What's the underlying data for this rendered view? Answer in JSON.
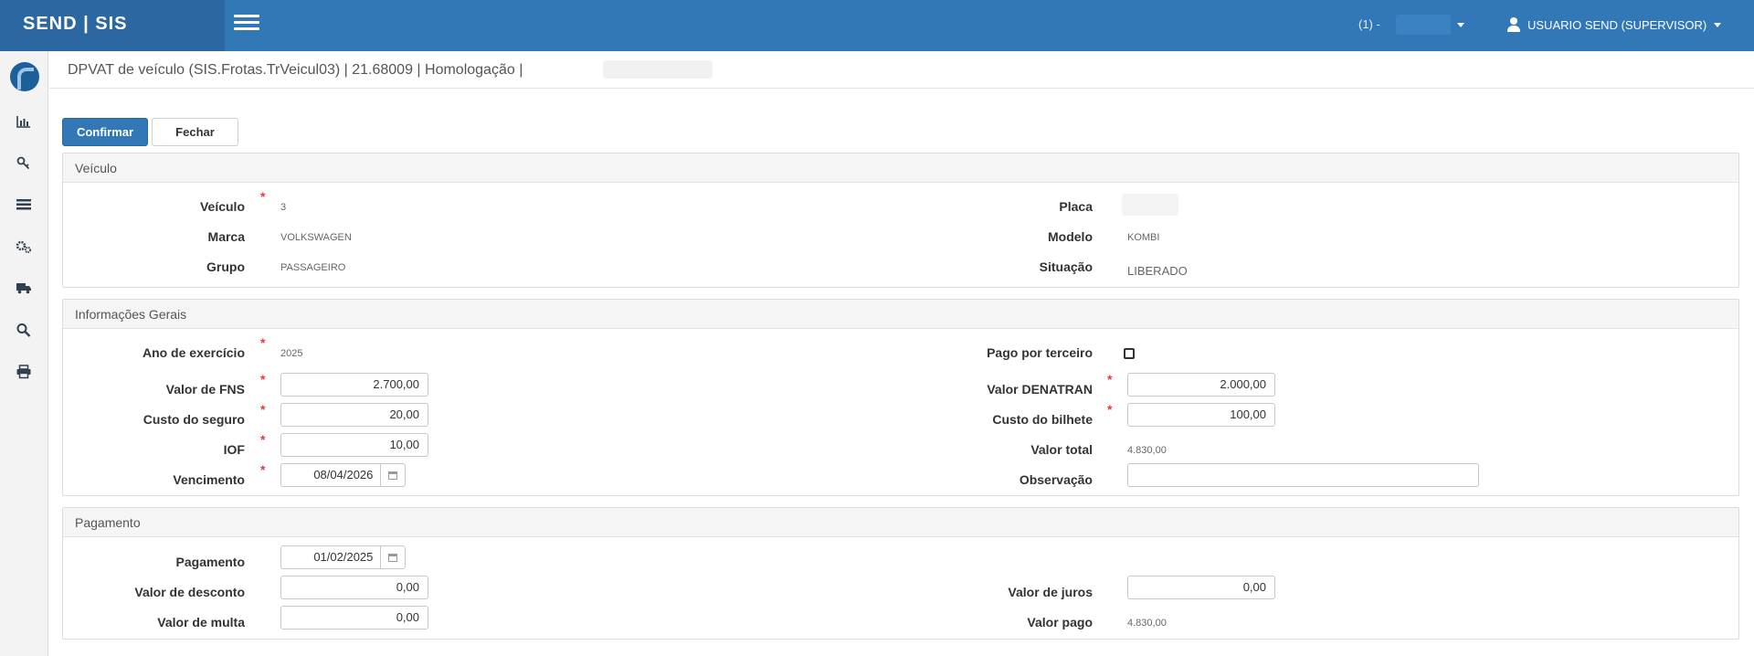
{
  "header": {
    "brand": "SEND | SIS",
    "company": "(1) -",
    "user": "USUARIO SEND (SUPERVISOR)"
  },
  "sidebar": {
    "icons": [
      "logo-icon",
      "bar-chart-icon",
      "key-icon",
      "list-icon",
      "cogs-icon",
      "truck-icon",
      "search-icon",
      "print-icon"
    ]
  },
  "page": {
    "title": "DPVAT de veículo (SIS.Frotas.TrVeicul03) | 21.68009 | Homologação |"
  },
  "toolbar": {
    "confirm_label": "Confirmar",
    "close_label": "Fechar"
  },
  "veiculo": {
    "heading": "Veículo",
    "veiculo_label": "Veículo",
    "veiculo_value": "3",
    "placa_label": "Placa",
    "marca_label": "Marca",
    "marca_value": "VOLKSWAGEN",
    "modelo_label": "Modelo",
    "modelo_value": "KOMBI",
    "grupo_label": "Grupo",
    "grupo_value": "PASSAGEIRO",
    "situacao_label": "Situação",
    "situacao_value": "LIBERADO"
  },
  "info": {
    "heading": "Informações Gerais",
    "ano_label": "Ano de exercício",
    "ano_value": "2025",
    "pago_label": "Pago por terceiro",
    "fns_label": "Valor de FNS",
    "fns_value": "2.700,00",
    "denatran_label": "Valor DENATRAN",
    "denatran_value": "2.000,00",
    "seguro_label": "Custo do seguro",
    "seguro_value": "20,00",
    "bilhete_label": "Custo do bilhete",
    "bilhete_value": "100,00",
    "iof_label": "IOF",
    "iof_value": "10,00",
    "total_label": "Valor total",
    "total_value": "4.830,00",
    "venc_label": "Vencimento",
    "venc_value": "08/04/2026",
    "obs_label": "Observação",
    "obs_value": ""
  },
  "pagamento": {
    "heading": "Pagamento",
    "pag_label": "Pagamento",
    "pag_value": "01/02/2025",
    "desconto_label": "Valor de desconto",
    "desconto_value": "0,00",
    "juros_label": "Valor de juros",
    "juros_value": "0,00",
    "multa_label": "Valor de multa",
    "multa_value": "0,00",
    "pago_label": "Valor pago",
    "pago_value": "4.830,00"
  }
}
